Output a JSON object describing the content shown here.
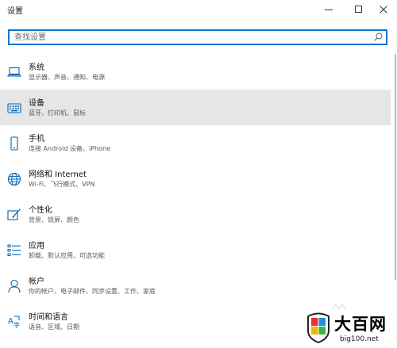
{
  "window": {
    "title": "设置",
    "minimize_icon": "minimize-icon",
    "maximize_icon": "maximize-icon",
    "close_icon": "close-icon"
  },
  "search": {
    "placeholder": "查找设置",
    "value": "",
    "icon": "search-icon"
  },
  "accent_color": "#0078d7",
  "selected_bg": "#e6e6e6",
  "items": [
    {
      "label": "系统",
      "desc": "显示器、声音、通知、电源",
      "icon": "laptop-icon"
    },
    {
      "label": "设备",
      "desc": "蓝牙、打印机、鼠标",
      "icon": "keyboard-icon",
      "selected": true
    },
    {
      "label": "手机",
      "desc": "连接 Android 设备、iPhone",
      "icon": "phone-icon"
    },
    {
      "label": "网络和 Internet",
      "desc": "Wi-Fi、飞行模式、VPN",
      "icon": "globe-icon"
    },
    {
      "label": "个性化",
      "desc": "背景、锁屏、颜色",
      "icon": "paint-brush-icon"
    },
    {
      "label": "应用",
      "desc": "卸载、默认应用、可选功能",
      "icon": "apps-list-icon"
    },
    {
      "label": "帐户",
      "desc": "你的帐户、电子邮件、同步设置、工作、家庭",
      "icon": "person-icon"
    },
    {
      "label": "时间和语言",
      "desc": "语音、区域、日期",
      "icon": "time-language-icon"
    }
  ],
  "watermark": {
    "text": "大百网",
    "url": "big100.net"
  }
}
